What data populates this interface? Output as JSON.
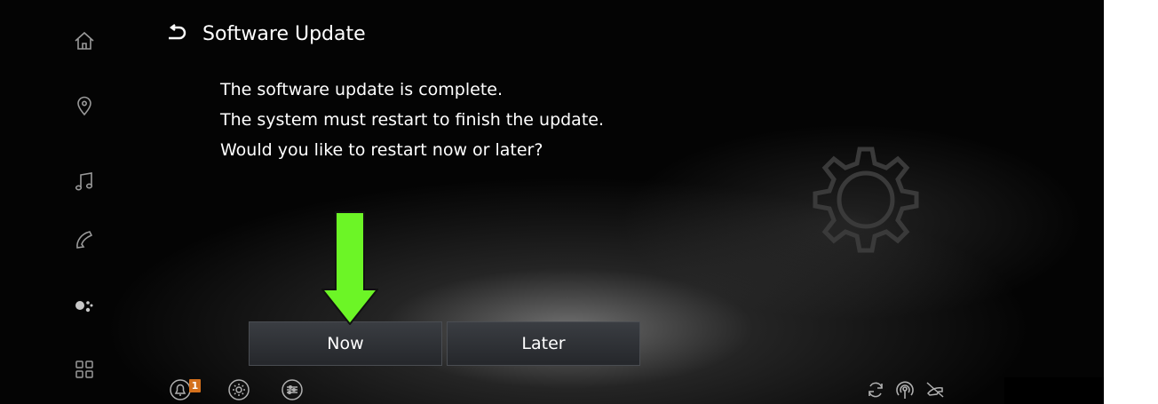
{
  "header": {
    "title": "Software Update",
    "back_icon": "back-arrow-icon"
  },
  "message": {
    "line1": "The software update is complete.",
    "line2": "The system must restart to finish the update.",
    "line3": "Would you like to restart now or later?"
  },
  "buttons": {
    "now_label": "Now",
    "later_label": "Later"
  },
  "sidebar": {
    "items": [
      {
        "icon": "home-icon"
      },
      {
        "icon": "location-pin-icon"
      },
      {
        "icon": "music-note-icon"
      },
      {
        "icon": "phone-icon"
      },
      {
        "icon": "voice-assistant-icon"
      },
      {
        "icon": "apps-grid-icon"
      }
    ]
  },
  "bottom_bar": {
    "notification_count": "1",
    "left_icons": [
      "notification-bell-icon",
      "settings-gear-icon",
      "sliders-icon"
    ],
    "right_icons": [
      "sync-icon",
      "wireless-signal-icon",
      "phone-disconnected-icon"
    ]
  },
  "colors": {
    "background": "#040404",
    "badge": "#d4701c",
    "arrow": "#6cf526",
    "button": "#2e3135"
  }
}
